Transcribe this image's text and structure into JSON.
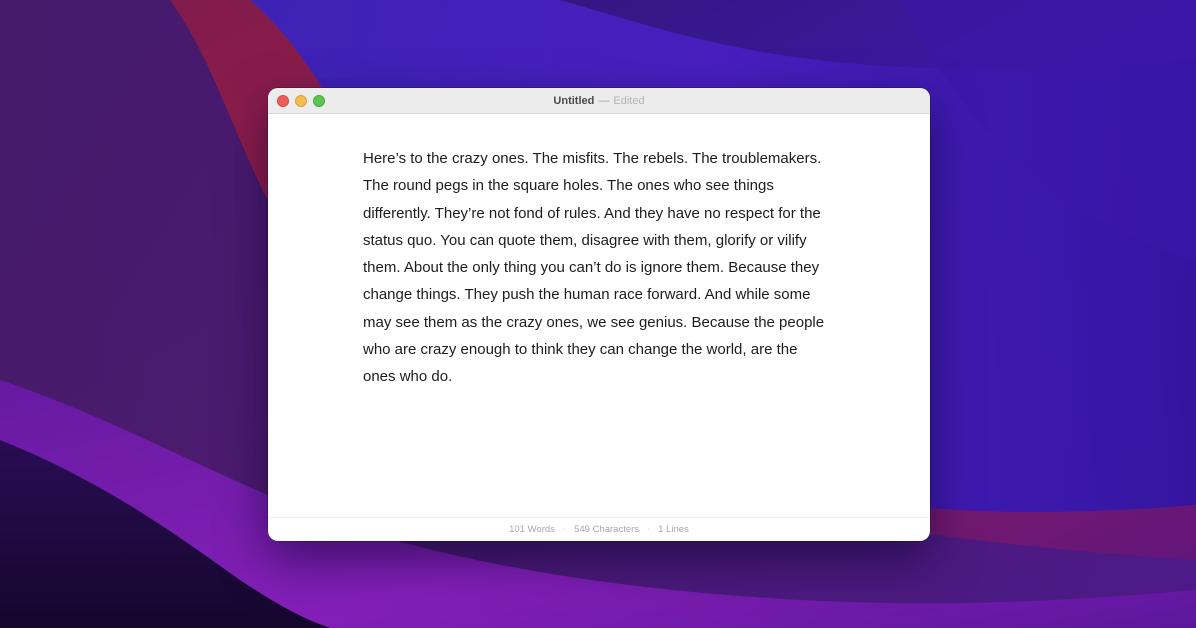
{
  "window": {
    "title": "Untitled",
    "title_separator": "—",
    "title_status": "Edited"
  },
  "editor": {
    "text": "Here’s to the crazy ones. The misfits. The rebels. The troublemakers. The round pegs in the square holes. The ones who see things differently. They’re not fond of rules. And they have no respect for the status quo. You can quote them, disagree with them, glorify or vilify them. About the only thing you can’t do is ignore them. Because they change things. They push the human race forward. And while some may see them as the crazy ones, we see genius. Because the people who are crazy enough to think they can change the world, are the ones who do."
  },
  "statusbar": {
    "words": "101 Words",
    "characters": "549 Characters",
    "lines": "1 Lines",
    "separator": "·"
  },
  "colors": {
    "close": "#ee5f57",
    "minimize": "#f5bd4f",
    "zoom": "#5dc454"
  }
}
